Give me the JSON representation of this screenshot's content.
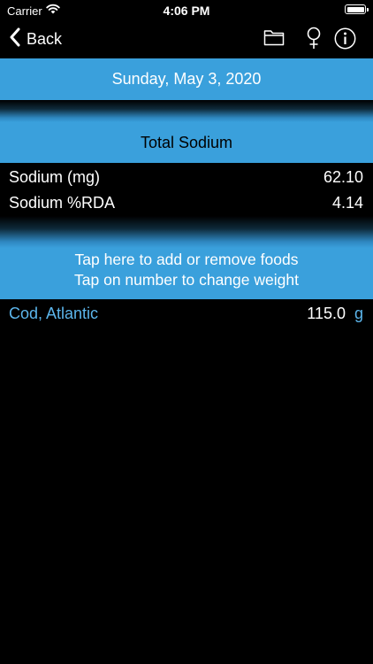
{
  "status_bar": {
    "carrier": "Carrier",
    "time": "4:06 PM"
  },
  "nav": {
    "back_label": "Back",
    "icons": [
      "folder-icon",
      "female-icon",
      "info-icon"
    ]
  },
  "date": "Sunday, May 3, 2020",
  "section_title": "Total Sodium",
  "nutrients": [
    {
      "label": "Sodium (mg)",
      "value": "62.10"
    },
    {
      "label": "Sodium %RDA",
      "value": "4.14"
    }
  ],
  "hint": {
    "line1": "Tap here to add or remove foods",
    "line2": "Tap on number to change weight"
  },
  "foods": [
    {
      "name": "Cod, Atlantic",
      "weight": "115.0",
      "unit": "g"
    }
  ],
  "colors": {
    "accent_bar": "#3aa0dc",
    "link": "#5cb6ec",
    "background": "#000000"
  }
}
